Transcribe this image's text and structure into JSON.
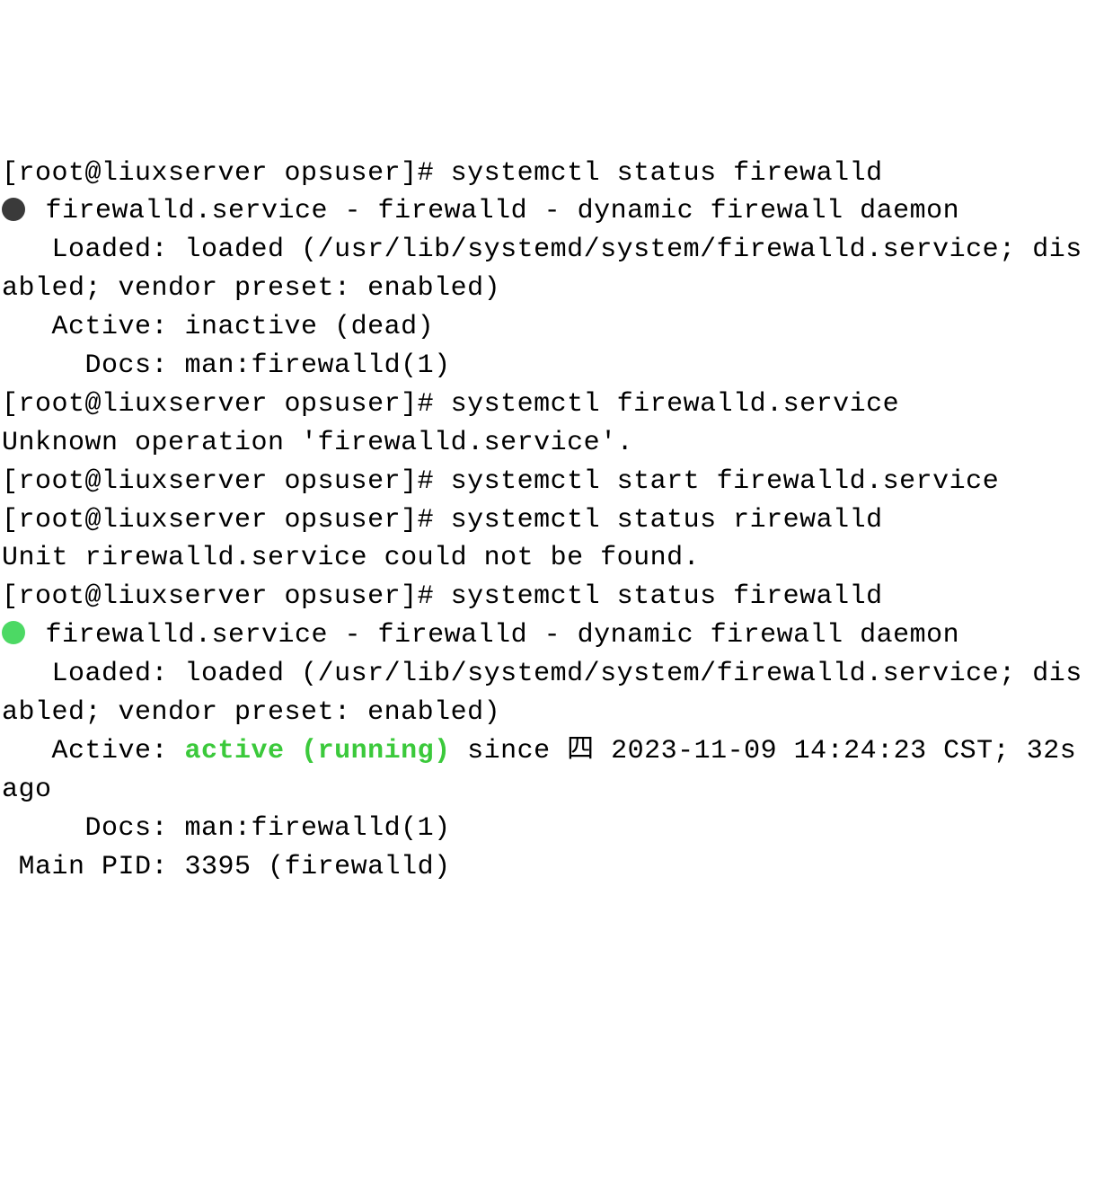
{
  "prompt": "[root@liuxserver opsuser]# ",
  "cmds": {
    "status1": "systemctl status firewalld",
    "bad1": "systemctl firewalld.service",
    "start": "systemctl start firewalld.service",
    "typo": "systemctl status rirewalld",
    "status2": "systemctl status firewalld"
  },
  "status1": {
    "header": " firewalld.service - firewalld - dynamic firewall daemon",
    "loaded": "   Loaded: loaded (/usr/lib/systemd/system/firewalld.service; disabled; vendor preset: enabled)",
    "active": "   Active: inactive (dead)",
    "docs": "     Docs: man:firewalld(1)"
  },
  "err1": "Unknown operation 'firewalld.service'.",
  "err2": "Unit rirewalld.service could not be found.",
  "status2": {
    "header": " firewalld.service - firewalld - dynamic firewall daemon",
    "loaded": "   Loaded: loaded (/usr/lib/systemd/system/firewalld.service; disabled; vendor preset: enabled)",
    "activeLabel": "   Active: ",
    "activeValue": "active (running)",
    "activeSince": " since 四 2023-11-09 14:24:23 CST; 32s ago",
    "docs": "     Docs: man:firewalld(1)",
    "mainpid": " Main PID: 3395 (firewalld)"
  }
}
